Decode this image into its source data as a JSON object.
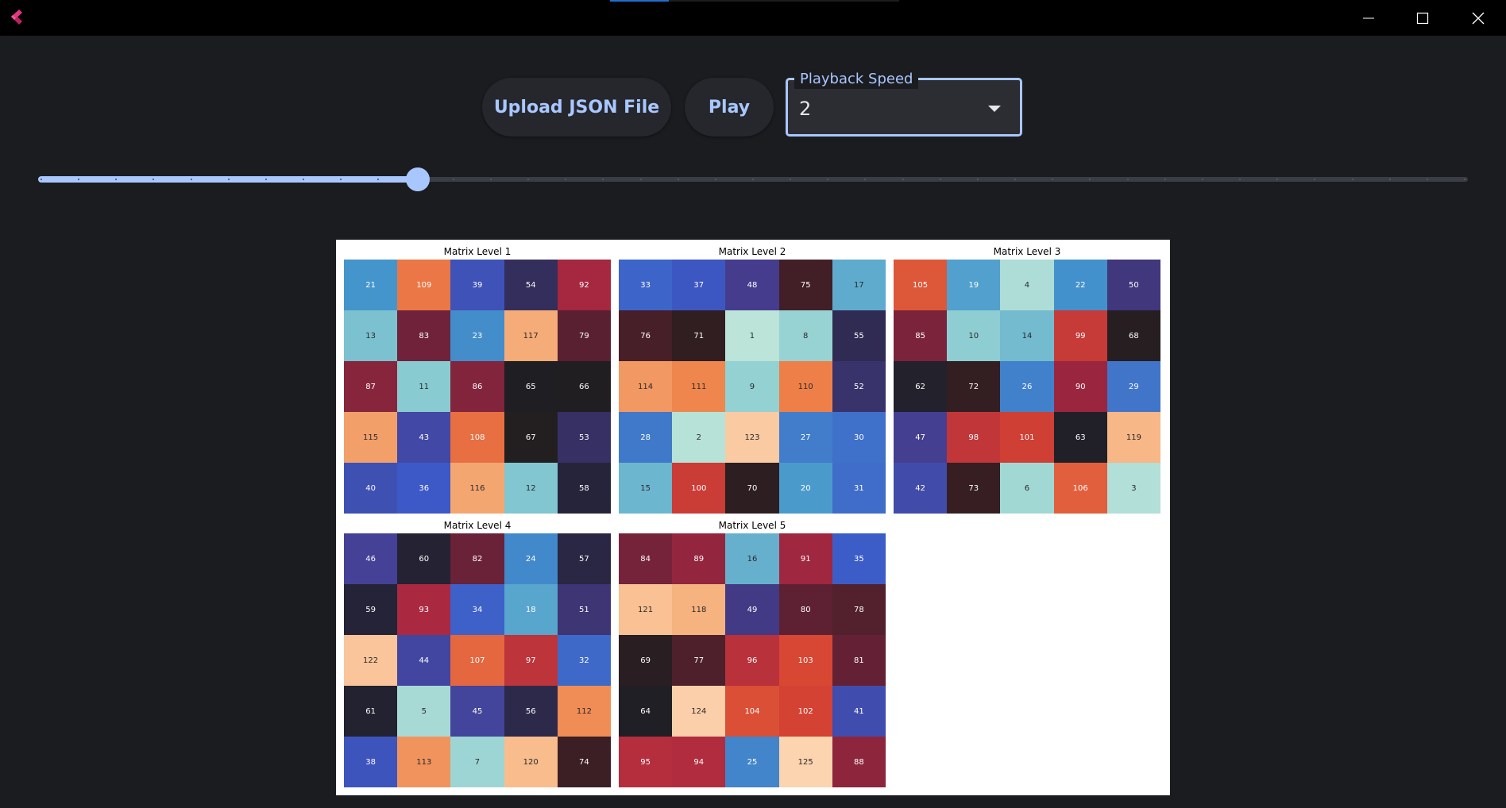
{
  "window": {
    "controls": [
      "minimize-icon",
      "maximize-icon",
      "close-icon"
    ],
    "logo_icon": "flutter-logo-icon"
  },
  "toolbar": {
    "upload_label": "Upload JSON File",
    "play_label": "Play",
    "speed_label": "Playback Speed",
    "speed_value": "2"
  },
  "slider": {
    "value": 10,
    "min": 0,
    "max": 38,
    "ticks": 39,
    "active_color": "#a9c7ff",
    "inactive_color": "#3a3d45"
  },
  "figure": {
    "matrices": [
      {
        "title": "Matrix Level 1",
        "values": [
          [
            21,
            109,
            39,
            54,
            92
          ],
          [
            13,
            83,
            23,
            117,
            79
          ],
          [
            87,
            11,
            86,
            65,
            66
          ],
          [
            115,
            43,
            108,
            67,
            53
          ],
          [
            40,
            36,
            116,
            12,
            58
          ]
        ]
      },
      {
        "title": "Matrix Level 2",
        "values": [
          [
            33,
            37,
            48,
            75,
            17
          ],
          [
            76,
            71,
            1,
            8,
            55
          ],
          [
            114,
            111,
            9,
            110,
            52
          ],
          [
            28,
            2,
            123,
            27,
            30
          ],
          [
            15,
            100,
            70,
            20,
            31
          ]
        ]
      },
      {
        "title": "Matrix Level 3",
        "values": [
          [
            105,
            19,
            4,
            22,
            50
          ],
          [
            85,
            10,
            14,
            99,
            68
          ],
          [
            62,
            72,
            26,
            90,
            29
          ],
          [
            47,
            98,
            101,
            63,
            119
          ],
          [
            42,
            73,
            6,
            106,
            3
          ]
        ]
      },
      {
        "title": "Matrix Level 4",
        "values": [
          [
            46,
            60,
            82,
            24,
            57
          ],
          [
            59,
            93,
            34,
            18,
            51
          ],
          [
            122,
            44,
            107,
            97,
            32
          ],
          [
            61,
            5,
            45,
            56,
            112
          ],
          [
            38,
            113,
            7,
            120,
            74
          ]
        ]
      },
      {
        "title": "Matrix Level 5",
        "values": [
          [
            84,
            89,
            16,
            91,
            35
          ],
          [
            121,
            118,
            49,
            80,
            78
          ],
          [
            69,
            77,
            96,
            103,
            81
          ],
          [
            64,
            124,
            104,
            102,
            41
          ],
          [
            95,
            94,
            25,
            125,
            88
          ]
        ]
      }
    ]
  }
}
